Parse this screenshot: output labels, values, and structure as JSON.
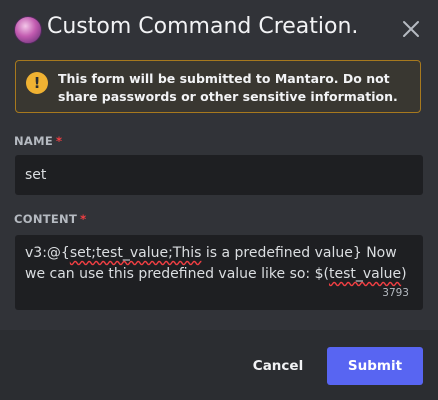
{
  "modal": {
    "title": "Custom Command Creation.",
    "close_icon": "close-icon",
    "avatar_icon": "bot-avatar"
  },
  "notice": {
    "icon": "warning-icon",
    "icon_glyph": "!",
    "text_before": "This form will be submitted to ",
    "app_name": "Mantaro",
    "text_after": ". Do not share passwords or other sensitive information.",
    "color_border": "#a7791e",
    "color_icon": "#f0b232"
  },
  "fields": {
    "name": {
      "label": "NAME",
      "required_mark": "*",
      "value": "set"
    },
    "content": {
      "label": "CONTENT",
      "required_mark": "*",
      "value_parts": [
        "v3:@{",
        "set;test_value;This",
        " is a predefined value} Now\nwe can use this predefined value like so: $(",
        "test_value",
        ")"
      ],
      "remaining_chars": "3793"
    }
  },
  "footer": {
    "cancel_label": "Cancel",
    "submit_label": "Submit",
    "submit_color": "#5865f2"
  }
}
